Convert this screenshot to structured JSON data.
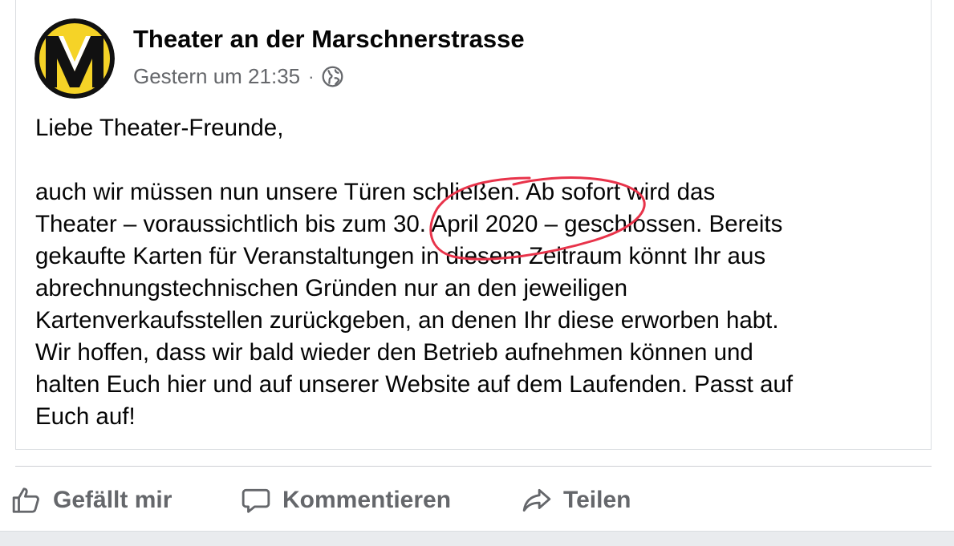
{
  "post": {
    "page_name": "Theater an der Marschnerstrasse",
    "timestamp": "Gestern um 21:35",
    "separator": "·",
    "audience_icon": "globe-icon",
    "avatar_letter": "M",
    "avatar_colors": {
      "background": "#f5d327",
      "letter": "#111111",
      "accent": "#ffffff"
    },
    "greeting": "Liebe Theater-Freunde,",
    "lines": [
      "auch wir müssen nun unsere Türen schließen. Ab sofort wird das",
      "Theater – voraussichtlich bis zum 30. April 2020 – geschlossen. Bereits",
      "gekaufte Karten für Veranstaltungen in diesem Zeitraum könnt Ihr aus",
      "abrechnungstechnischen Gründen nur an den jeweiligen",
      "Kartenverkaufsstellen zurückgeben, an denen Ihr diese erworben habt.",
      "Wir hoffen, dass wir bald wieder den Betrieb aufnehmen können und",
      "halten Euch hier und auf unserer Website auf dem Laufenden. Passt auf",
      "Euch auf!"
    ],
    "highlight_color": "#e8334a"
  },
  "actions": {
    "like_label": "Gefällt mir",
    "comment_label": "Kommentieren",
    "share_label": "Teilen",
    "like_icon": "thumbs-up-icon",
    "comment_icon": "comment-bubble-icon",
    "share_icon": "share-arrow-icon"
  }
}
